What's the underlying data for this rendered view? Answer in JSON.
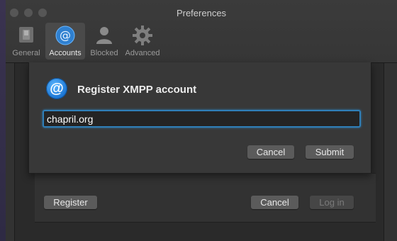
{
  "window": {
    "title": "Preferences"
  },
  "tabs": [
    {
      "label": "General",
      "icon": "switch-icon",
      "active": false
    },
    {
      "label": "Accounts",
      "icon": "at-sign-icon",
      "active": true
    },
    {
      "label": "Blocked",
      "icon": "person-icon",
      "active": false
    },
    {
      "label": "Advanced",
      "icon": "gear-icon",
      "active": false
    }
  ],
  "sheet": {
    "title": "Register XMPP account",
    "server_value": "chapril.org",
    "cancel_label": "Cancel",
    "submit_label": "Submit"
  },
  "footer": {
    "register_label": "Register",
    "cancel_label": "Cancel",
    "login_label": "Log in"
  },
  "colors": {
    "accent": "#2f7fb8",
    "window_bg": "#323232",
    "button": "#5b5b5b"
  }
}
